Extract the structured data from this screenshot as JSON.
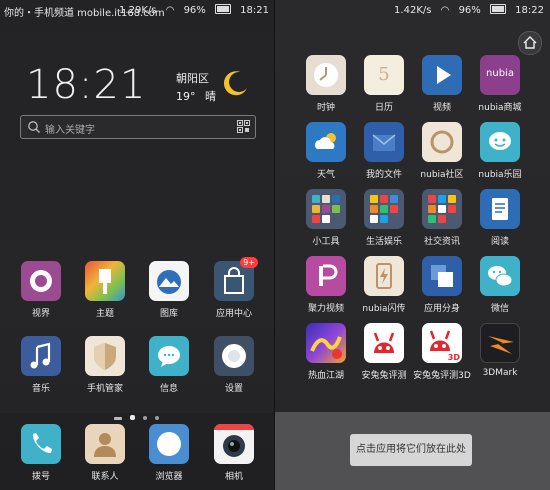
{
  "left_screen": {
    "status": {
      "left_text": "你的・手机频道 mobile.it168.com",
      "speed": "1.29K/s",
      "battery": "96%",
      "time": "18:21"
    },
    "clock": "18:21",
    "weather": {
      "location": "朝阳区",
      "temperature": "19°",
      "condition": "晴",
      "icon": "crescent-moon-icon"
    },
    "search": {
      "placeholder": "输入关键字"
    },
    "apps_row1": [
      {
        "label": "视界",
        "icon": "camera-lens-icon",
        "color": "#9b4b8f"
      },
      {
        "label": "主题",
        "icon": "brush-icon",
        "color": "#e7a93a"
      },
      {
        "label": "图库",
        "icon": "gallery-icon",
        "color": "#ffffff"
      },
      {
        "label": "应用中心",
        "icon": "shopping-bag-icon",
        "color": "#3b5673",
        "badge": "9+"
      }
    ],
    "apps_row2": [
      {
        "label": "音乐",
        "icon": "music-note-icon",
        "color": "#3c5c9c"
      },
      {
        "label": "手机管家",
        "icon": "shield-icon",
        "color": "#f0e6d8"
      },
      {
        "label": "信息",
        "icon": "chat-bubble-icon",
        "color": "#3fb2c9"
      },
      {
        "label": "设置",
        "icon": "settings-dial-icon",
        "color": "#3f4f66"
      }
    ],
    "dock": [
      {
        "label": "拨号",
        "icon": "phone-icon",
        "color": "#3fb2c9"
      },
      {
        "label": "联系人",
        "icon": "contact-icon",
        "color": "#e9d5bb"
      },
      {
        "label": "浏览器",
        "icon": "compass-icon",
        "color": "#4a8ed1"
      },
      {
        "label": "相机",
        "icon": "camera-icon",
        "color": "#2f3a49"
      }
    ]
  },
  "right_screen": {
    "status": {
      "speed": "1.42K/s",
      "battery": "96%",
      "time": "18:22"
    },
    "rows": [
      [
        {
          "label": "时钟",
          "icon": "clock-icon",
          "color": "#e8ddd2"
        },
        {
          "label": "日历",
          "icon": "calendar-icon",
          "color": "#f3eede",
          "text": "5"
        },
        {
          "label": "视频",
          "icon": "play-icon",
          "color": "#2e6db6"
        },
        {
          "label": "nubia商城",
          "icon": "nubia-logo-icon",
          "color": "#8c3f8d",
          "text": "nubia"
        }
      ],
      [
        {
          "label": "天气",
          "icon": "cloud-icon",
          "color": "#2e79c4"
        },
        {
          "label": "我的文件",
          "icon": "folder-icon",
          "color": "#2f5fa8"
        },
        {
          "label": "nubia社区",
          "icon": "community-icon",
          "color": "#f0e6d8"
        },
        {
          "label": "nubia乐园",
          "icon": "smiley-chat-icon",
          "color": "#3fb2c9"
        }
      ],
      [
        {
          "label": "小工具",
          "icon": "folder-grid-icon",
          "color": "#4b5a70"
        },
        {
          "label": "生活娱乐",
          "icon": "folder-grid-icon",
          "color": "#4b5a70"
        },
        {
          "label": "社交资讯",
          "icon": "folder-grid-icon",
          "color": "#4b5a70"
        },
        {
          "label": "阅读",
          "icon": "book-icon",
          "color": "#2e6db6"
        }
      ],
      [
        {
          "label": "聚力视频",
          "icon": "pptv-icon",
          "color": "#b74ba1"
        },
        {
          "label": "nubia闪传",
          "icon": "flash-transfer-icon",
          "color": "#f0e6d8"
        },
        {
          "label": "应用分身",
          "icon": "app-clone-icon",
          "color": "#2f5fa8"
        },
        {
          "label": "微信",
          "icon": "wechat-icon",
          "color": "#3fb2c9"
        }
      ],
      [
        {
          "label": "热血江湖",
          "icon": "game-icon",
          "color": "#6a3fc8"
        },
        {
          "label": "安兔兔评测",
          "icon": "antutu-icon",
          "color": "#ffffff"
        },
        {
          "label": "安兔兔评测3D",
          "icon": "antutu3d-icon",
          "color": "#ffffff",
          "text": "3D"
        },
        {
          "label": "3DMark",
          "icon": "3dmark-icon",
          "color": "#1e1e22"
        }
      ]
    ],
    "drop_hint": "点击应用将它们放在此处"
  }
}
